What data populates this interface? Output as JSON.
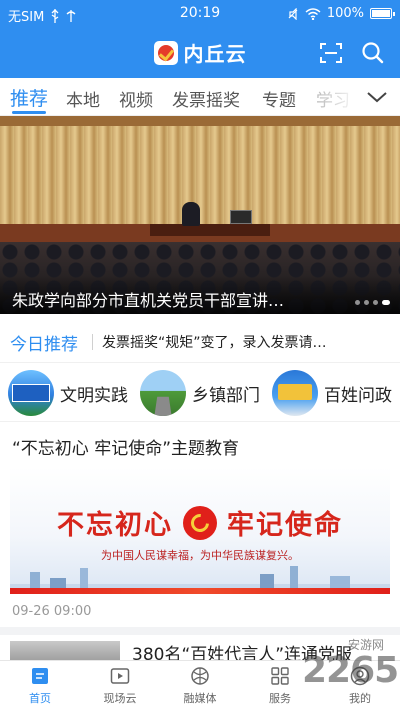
{
  "status_bar": {
    "carrier": "无SIM",
    "time": "20:19",
    "battery": "100%"
  },
  "header": {
    "title": "内丘云",
    "icons": [
      "scan-icon",
      "search-icon"
    ],
    "accent_color": "#2f8ef0"
  },
  "tabs": [
    {
      "label": "推荐",
      "active": true
    },
    {
      "label": "本地"
    },
    {
      "label": "视频"
    },
    {
      "label": "发票摇奖"
    },
    {
      "label": "专题"
    },
    {
      "label": "学习"
    }
  ],
  "banner": {
    "caption": "朱政学向部分市直机关党员干部宣讲…",
    "slide_count": 4,
    "active_slide": 4
  },
  "today": {
    "label": "今日推荐",
    "headline": "发票摇奖“规矩”变了，录入发票请…"
  },
  "shortcuts": [
    {
      "label": "文明实践",
      "thumb_text": "文明实践"
    },
    {
      "label": "乡镇部门"
    },
    {
      "label": "百姓问政"
    }
  ],
  "article": {
    "title": "“不忘初心 牢记使命”主题教育",
    "image_slogan_left": "不忘初心",
    "image_slogan_right": "牢记使命",
    "image_subline": "为中国人民谋幸福，为中华民族谋复兴。",
    "time": "09-26 09:00"
  },
  "next_article": {
    "title": "380名“百姓代言人”连通党服"
  },
  "bottom_nav": [
    {
      "label": "首页",
      "icon": "home-icon",
      "active": true
    },
    {
      "label": "现场云",
      "icon": "play-icon"
    },
    {
      "label": "融媒体",
      "icon": "globe-icon"
    },
    {
      "label": "服务",
      "icon": "grid-icon"
    },
    {
      "label": "我的",
      "icon": "user-icon"
    }
  ],
  "watermark": {
    "digits": "2265",
    "text": "安游网"
  }
}
